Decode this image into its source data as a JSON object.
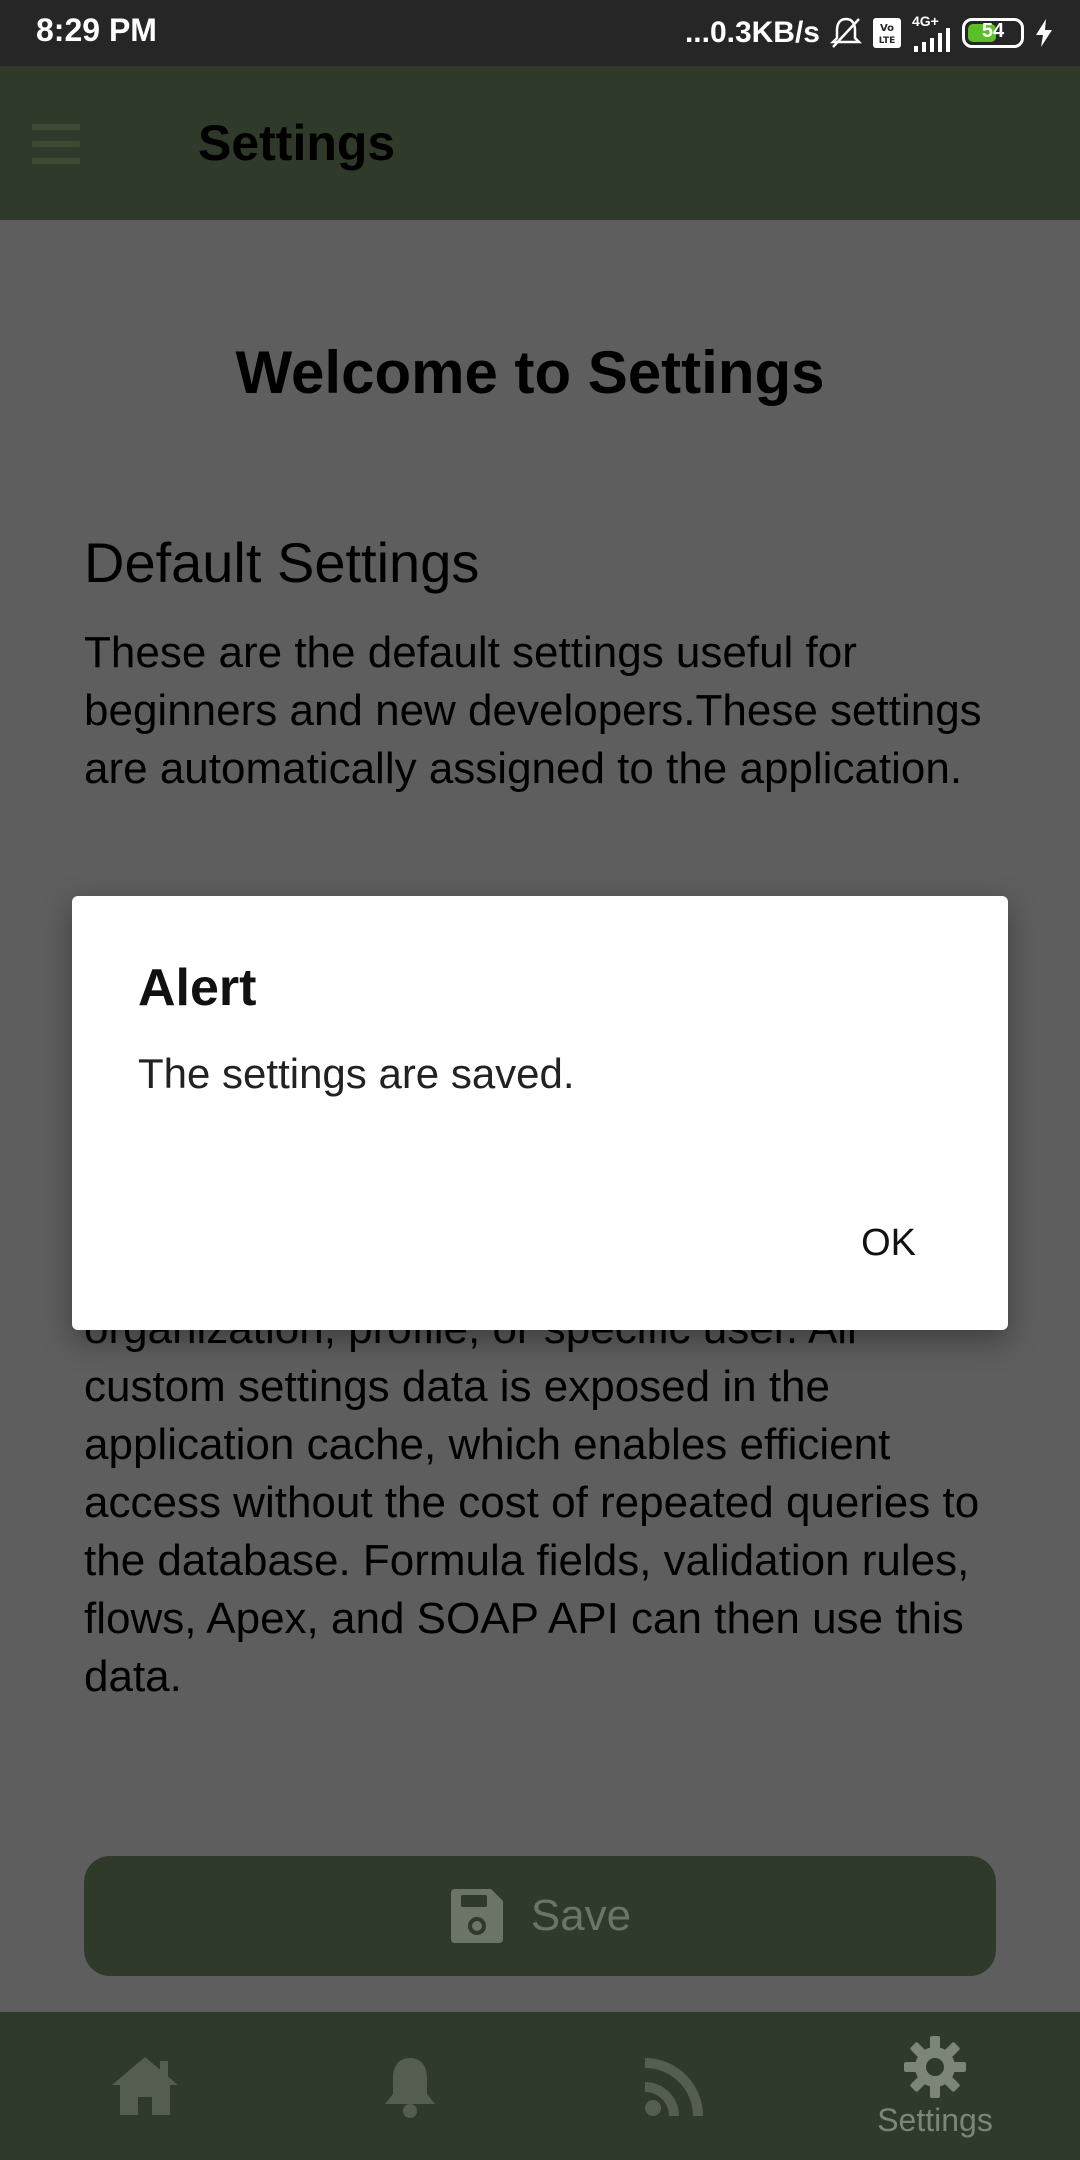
{
  "status_bar": {
    "time": "8:29 PM",
    "network_speed": "...0.3KB/s",
    "network_type": "4G+",
    "battery": "54",
    "icons": [
      "mute-bell-icon",
      "volte-icon",
      "signal-icon",
      "battery-icon",
      "charging-icon"
    ]
  },
  "appbar": {
    "title": "Settings",
    "menu_icon": "menu-icon"
  },
  "content": {
    "welcome": "Welcome to Settings",
    "default_title": "Default Settings",
    "default_body": "These are the default settings useful for beginners and new developers.These settings are automatically assigned to the application.",
    "custom_body": "organization, profile, or specific user. All custom settings data is exposed in the application cache, which enables efficient access without the cost of repeated queries to the database. Formula fields, validation rules, flows, Apex, and SOAP API can then use this data."
  },
  "save_button": {
    "label": "Save",
    "icon": "save-icon"
  },
  "bottom_nav": {
    "items": [
      {
        "icon": "home-icon",
        "label": ""
      },
      {
        "icon": "bell-icon",
        "label": ""
      },
      {
        "icon": "rss-icon",
        "label": ""
      },
      {
        "icon": "settings-icon",
        "label": "Settings"
      }
    ]
  },
  "dialog": {
    "title": "Alert",
    "message": "The settings are saved.",
    "ok_label": "OK"
  },
  "colors": {
    "appbar": "#2f3a2a",
    "scrim_background": "#5e5e5e",
    "battery_fill": "#5bbf28"
  }
}
